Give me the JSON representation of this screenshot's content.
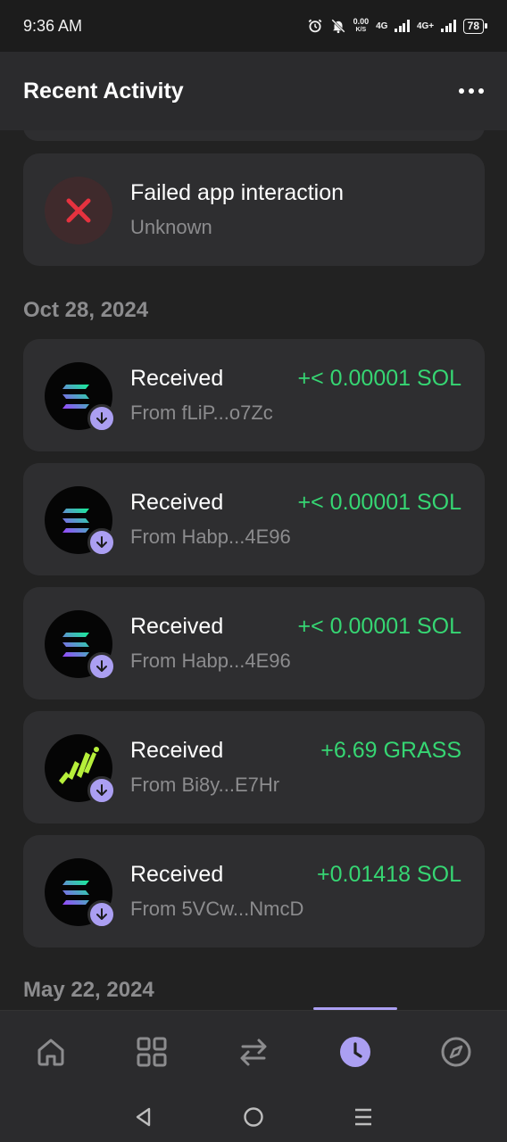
{
  "status_bar": {
    "time": "9:36 AM",
    "net_speed_value": "0.00",
    "net_speed_unit": "K/S",
    "network_1": "4G",
    "network_2": "4G+",
    "battery": "78"
  },
  "header": {
    "title": "Recent Activity",
    "menu_icon": "more-horizontal-icon"
  },
  "activity": [
    {
      "type": "failed",
      "title": "Failed app interaction",
      "subtitle": "Unknown",
      "icon": "x-icon"
    }
  ],
  "groups": [
    {
      "date": "Oct 28, 2024",
      "items": [
        {
          "title": "Received",
          "from": "From fLiP...o7Zc",
          "amount": "+< 0.00001 SOL",
          "token_icon": "solana-logo-icon"
        },
        {
          "title": "Received",
          "from": "From Habp...4E96",
          "amount": "+< 0.00001 SOL",
          "token_icon": "solana-logo-icon"
        },
        {
          "title": "Received",
          "from": "From Habp...4E96",
          "amount": "+< 0.00001 SOL",
          "token_icon": "solana-logo-icon"
        },
        {
          "title": "Received",
          "from": "From Bi8y...E7Hr",
          "amount": "+6.69 GRASS",
          "token_icon": "grass-logo-icon"
        },
        {
          "title": "Received",
          "from": "From 5VCw...NmcD",
          "amount": "+0.01418 SOL",
          "token_icon": "solana-logo-icon"
        }
      ]
    },
    {
      "date": "May 22, 2024",
      "items": []
    }
  ],
  "bottom_nav": [
    {
      "name": "home",
      "icon": "home-icon",
      "active": false
    },
    {
      "name": "collectibles",
      "icon": "grid-icon",
      "active": false
    },
    {
      "name": "swap",
      "icon": "swap-arrows-icon",
      "active": false
    },
    {
      "name": "activity",
      "icon": "clock-icon",
      "active": true
    },
    {
      "name": "explore",
      "icon": "compass-icon",
      "active": false
    }
  ],
  "colors": {
    "background": "#222222",
    "card": "#2e2e30",
    "accent": "#ab9ff2",
    "positive": "#36d673",
    "error": "#e5323f",
    "muted_text": "#8c8c8e"
  }
}
